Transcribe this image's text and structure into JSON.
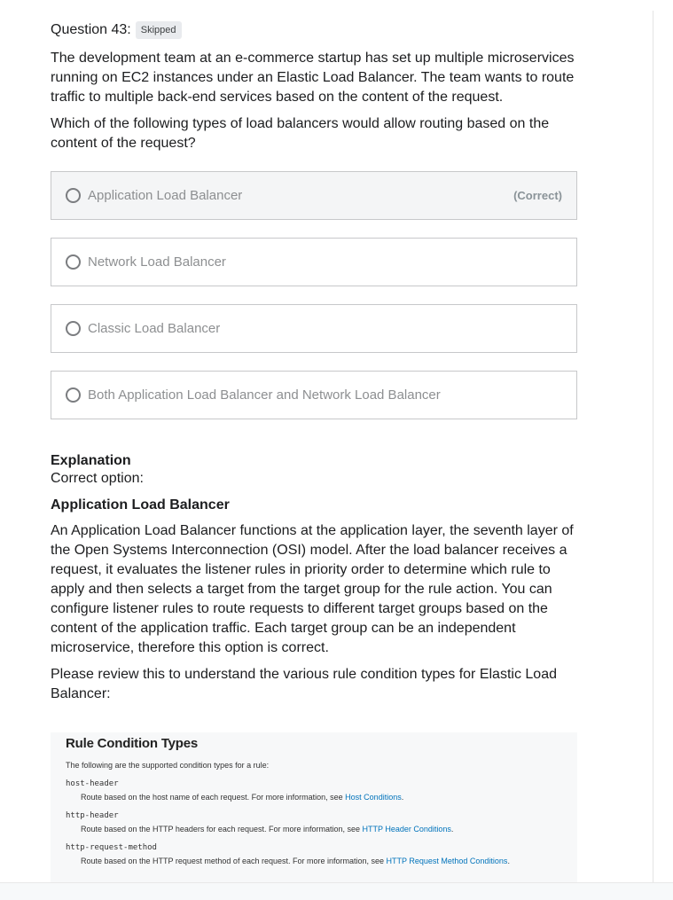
{
  "question": {
    "title": "Question 43:",
    "status_badge": "Skipped",
    "paragraphs": [
      "The development team at an e-commerce startup has set up multiple microservices running on EC2 instances under an Elastic Load Balancer. The team wants to route traffic to multiple back-end services based on the content of the request.",
      "Which of the following types of load balancers would allow routing based on the content of the request?"
    ]
  },
  "options": [
    {
      "label": "Application Load Balancer",
      "tag": "(Correct)"
    },
    {
      "label": "Network Load Balancer",
      "tag": ""
    },
    {
      "label": "Classic Load Balancer",
      "tag": ""
    },
    {
      "label": "Both Application Load Balancer and Network Load Balancer",
      "tag": ""
    }
  ],
  "explanation": {
    "heading": "Explanation",
    "correct_option_label": "Correct option:",
    "correct_option_name": "Application Load Balancer",
    "paragraphs": [
      "An Application Load Balancer functions at the application layer, the seventh layer of the Open Systems Interconnection (OSI) model. After the load balancer receives a request, it evaluates the listener rules in priority order to determine which rule to apply and then selects a target from the target group for the rule action. You can configure listener rules to route requests to different target groups based on the content of the application traffic. Each target group can be an independent microservice, therefore this option is correct.",
      "Please review this to understand the various rule condition types for Elastic Load Balancer:"
    ]
  },
  "doc_image": {
    "title": "Rule Condition Types",
    "intro": "The following are the supported condition types for a rule:",
    "items": [
      {
        "code": "host-header",
        "desc": "Route based on the host name of each request. For more information, see ",
        "link": "Host Conditions",
        "end": "."
      },
      {
        "code": "http-header",
        "desc": "Route based on the HTTP headers for each request. For more information, see ",
        "link": "HTTP Header Conditions",
        "end": "."
      },
      {
        "code": "http-request-method",
        "desc": "Route based on the HTTP request method of each request. For more information, see ",
        "link": "HTTP Request Method Conditions",
        "end": "."
      }
    ]
  }
}
